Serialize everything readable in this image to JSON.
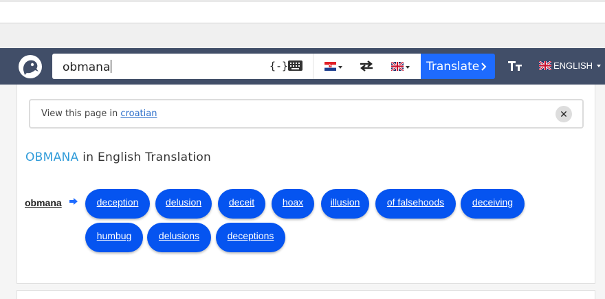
{
  "search": {
    "value": "obmana"
  },
  "search_tools": {
    "special_chars": "{-}"
  },
  "translate_label": "Translate",
  "site_language": "ENGLISH",
  "notice": {
    "prefix": "View this page in ",
    "link": "croatian",
    "close": "✕"
  },
  "heading": {
    "word": "OBMANA",
    "suffix": " in English Translation"
  },
  "source_word": "obmana",
  "translations": [
    "deception",
    "delusion",
    "deceit",
    "hoax",
    "illusion",
    "of falsehoods",
    "deceiving",
    "humbug",
    "delusions",
    "deceptions"
  ]
}
